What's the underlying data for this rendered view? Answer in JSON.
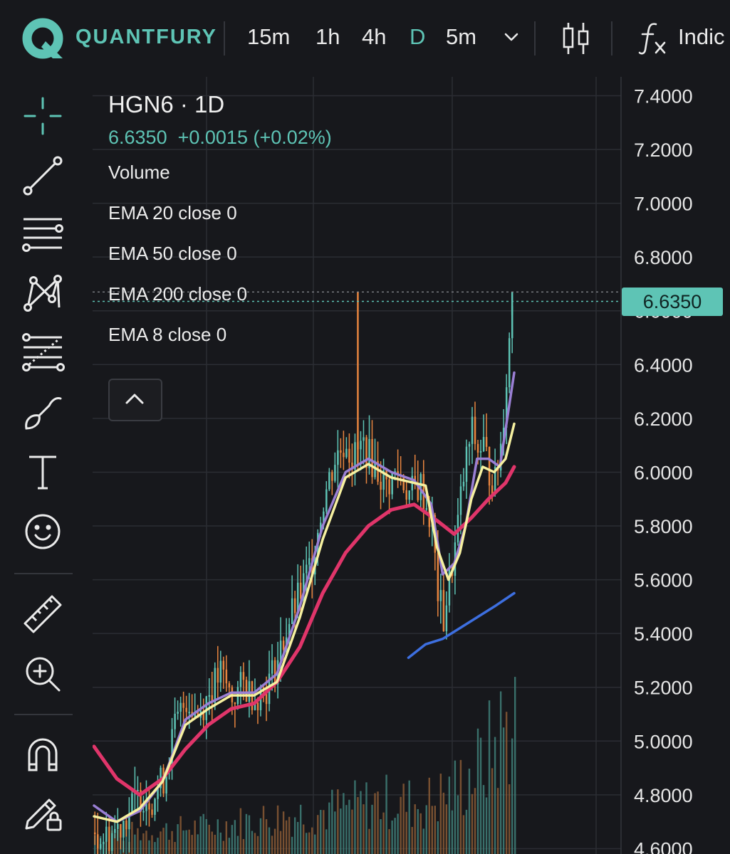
{
  "app": {
    "brand": "QUANTFURY",
    "accent": "#5ec4b5"
  },
  "toolbar_top": {
    "timeframes": [
      {
        "label": "15m",
        "active": false
      },
      {
        "label": "1h",
        "active": false
      },
      {
        "label": "4h",
        "active": false
      },
      {
        "label": "D",
        "active": true
      },
      {
        "label": "5m",
        "active": false
      }
    ],
    "more_icon": "chevron-down-icon",
    "chart_type_icon": "candlestick-icon",
    "indicators_icon": "fx-icon",
    "indicators_label": "Indic"
  },
  "toolbar_left": {
    "tools": [
      "crosshair-icon",
      "trend-line-icon",
      "horizontal-lines-icon",
      "pattern-icon",
      "fib-retracement-icon",
      "brush-icon",
      "text-icon",
      "emoji-icon",
      "ruler-icon",
      "zoom-in-icon",
      "magnet-icon",
      "lock-drawings-icon"
    ]
  },
  "legend": {
    "symbol": "HGN6 · 1D",
    "price": "6.6350",
    "change": "+0.0015 (+0.02%)",
    "indicators": [
      "Volume",
      "EMA 20 close 0",
      "EMA 50 close 0",
      "EMA 200 close 0",
      "EMA 8 close 0"
    ],
    "collapse_icon": "chevron-up-icon"
  },
  "price_axis": {
    "ticks": [
      "7.4000",
      "7.2000",
      "7.0000",
      "6.8000",
      "6.6000",
      "6.4000",
      "6.2000",
      "6.0000",
      "5.8000",
      "5.6000",
      "5.4000",
      "5.2000",
      "5.0000",
      "4.8000",
      "4.6000"
    ],
    "current_price_label": "6.6350"
  },
  "chart_data": {
    "type": "candlestick",
    "y_range": [
      4.58,
      7.47
    ],
    "current_price": 6.635,
    "ylabel": "",
    "colors": {
      "up": "#5ec4b5",
      "down": "#e8853f",
      "ema8": "#f6f0a0",
      "ema20": "#9a7fd4",
      "ema50": "#e0356a",
      "ema200": "#3d6fe0",
      "volume_up": "#3f7f78",
      "volume_down": "#8a5a35"
    },
    "close_path": [
      [
        0,
        4.66
      ],
      [
        4,
        4.64
      ],
      [
        8,
        4.68
      ],
      [
        12,
        4.74
      ],
      [
        16,
        4.8
      ],
      [
        20,
        4.79
      ],
      [
        24,
        4.86
      ],
      [
        28,
        5.05
      ],
      [
        32,
        5.16
      ],
      [
        36,
        5.1
      ],
      [
        40,
        5.18
      ],
      [
        44,
        5.25
      ],
      [
        48,
        5.16
      ],
      [
        52,
        5.21
      ],
      [
        56,
        5.17
      ],
      [
        60,
        5.2
      ],
      [
        64,
        5.3
      ],
      [
        68,
        5.45
      ],
      [
        72,
        5.55
      ],
      [
        76,
        5.68
      ],
      [
        80,
        5.9
      ],
      [
        84,
        6.05
      ],
      [
        88,
        6.12
      ],
      [
        90,
        6.05
      ],
      [
        94,
        6.1
      ],
      [
        98,
        6.02
      ],
      [
        102,
        5.95
      ],
      [
        106,
        6.0
      ],
      [
        110,
        5.92
      ],
      [
        114,
        5.95
      ],
      [
        118,
        5.8
      ],
      [
        120,
        5.55
      ],
      [
        122,
        5.45
      ],
      [
        124,
        5.6
      ],
      [
        126,
        5.72
      ],
      [
        128,
        5.9
      ],
      [
        130,
        6.05
      ],
      [
        132,
        6.15
      ],
      [
        134,
        6.08
      ],
      [
        136,
        6.1
      ],
      [
        138,
        6.0
      ],
      [
        140,
        5.96
      ],
      [
        142,
        6.1
      ],
      [
        144,
        6.35
      ],
      [
        146,
        6.635
      ]
    ],
    "spike_highs": [
      {
        "bar": 92,
        "high": 6.67
      },
      {
        "bar": 146,
        "high": 6.67
      }
    ],
    "ema8": [
      [
        0,
        4.72
      ],
      [
        8,
        4.7
      ],
      [
        16,
        4.75
      ],
      [
        24,
        4.85
      ],
      [
        32,
        5.06
      ],
      [
        40,
        5.12
      ],
      [
        48,
        5.17
      ],
      [
        56,
        5.17
      ],
      [
        64,
        5.22
      ],
      [
        72,
        5.46
      ],
      [
        80,
        5.75
      ],
      [
        88,
        5.98
      ],
      [
        96,
        6.03
      ],
      [
        104,
        5.98
      ],
      [
        112,
        5.96
      ],
      [
        116,
        5.95
      ],
      [
        120,
        5.72
      ],
      [
        124,
        5.6
      ],
      [
        128,
        5.7
      ],
      [
        132,
        5.9
      ],
      [
        136,
        6.02
      ],
      [
        140,
        6.0
      ],
      [
        144,
        6.05
      ],
      [
        147,
        6.18
      ]
    ],
    "ema20": [
      [
        0,
        4.76
      ],
      [
        8,
        4.7
      ],
      [
        16,
        4.74
      ],
      [
        24,
        4.85
      ],
      [
        32,
        5.08
      ],
      [
        40,
        5.14
      ],
      [
        48,
        5.18
      ],
      [
        56,
        5.18
      ],
      [
        64,
        5.25
      ],
      [
        72,
        5.5
      ],
      [
        80,
        5.8
      ],
      [
        88,
        6.0
      ],
      [
        96,
        6.05
      ],
      [
        104,
        6.0
      ],
      [
        112,
        5.97
      ],
      [
        118,
        5.88
      ],
      [
        122,
        5.62
      ],
      [
        126,
        5.66
      ],
      [
        130,
        5.8
      ],
      [
        134,
        6.05
      ],
      [
        138,
        6.05
      ],
      [
        142,
        6.02
      ],
      [
        147,
        6.37
      ]
    ],
    "ema50": [
      [
        0,
        4.98
      ],
      [
        8,
        4.86
      ],
      [
        16,
        4.8
      ],
      [
        24,
        4.86
      ],
      [
        32,
        4.97
      ],
      [
        40,
        5.06
      ],
      [
        48,
        5.12
      ],
      [
        56,
        5.14
      ],
      [
        64,
        5.22
      ],
      [
        72,
        5.35
      ],
      [
        80,
        5.55
      ],
      [
        88,
        5.7
      ],
      [
        96,
        5.8
      ],
      [
        104,
        5.86
      ],
      [
        112,
        5.88
      ],
      [
        120,
        5.82
      ],
      [
        126,
        5.77
      ],
      [
        132,
        5.83
      ],
      [
        138,
        5.9
      ],
      [
        144,
        5.96
      ],
      [
        147,
        6.02
      ]
    ],
    "ema200": [
      [
        110,
        5.31
      ],
      [
        116,
        5.36
      ],
      [
        122,
        5.38
      ],
      [
        128,
        5.42
      ],
      [
        134,
        5.46
      ],
      [
        140,
        5.5
      ],
      [
        147,
        5.55
      ]
    ],
    "volume_profile": [
      [
        0,
        0.15
      ],
      [
        20,
        0.18
      ],
      [
        40,
        0.22
      ],
      [
        60,
        0.28
      ],
      [
        80,
        0.34
      ],
      [
        100,
        0.42
      ],
      [
        115,
        0.4
      ],
      [
        125,
        0.5
      ],
      [
        135,
        0.7
      ],
      [
        142,
        0.95
      ],
      [
        147,
        1.1
      ]
    ]
  }
}
